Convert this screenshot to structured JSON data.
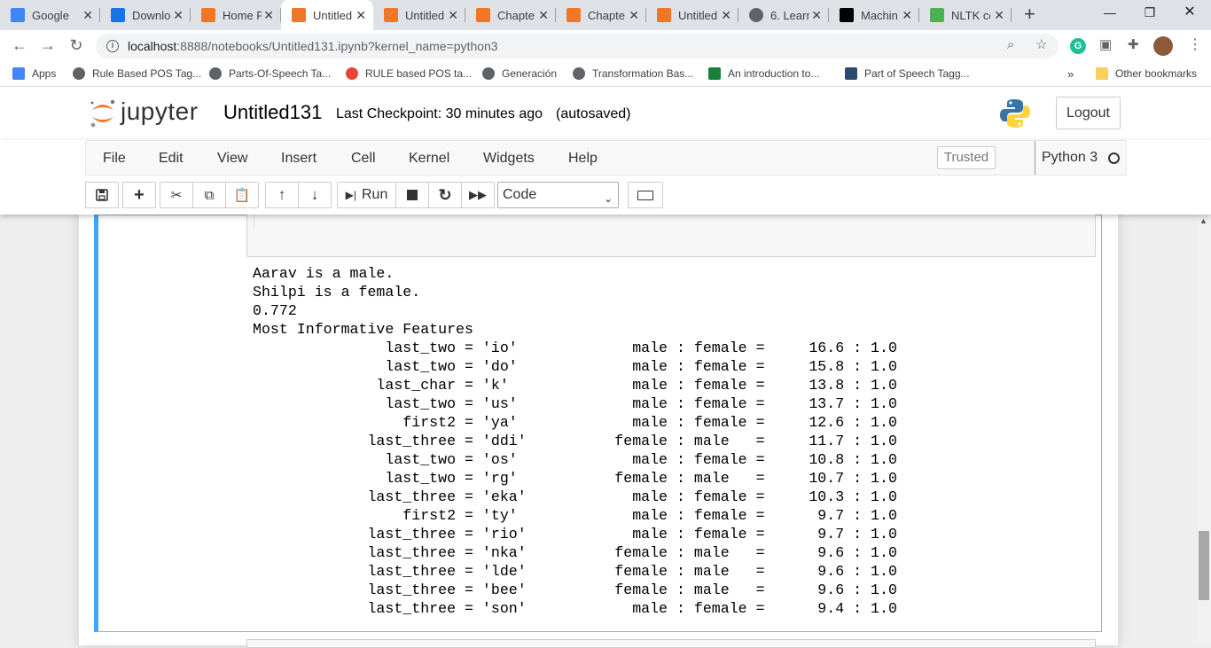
{
  "browser": {
    "tabs": [
      {
        "label": "Google",
        "icon": "google-docs-icon",
        "color": "#4285f4"
      },
      {
        "label": "Downlo",
        "icon": "download-icon",
        "color": "#1a73e8"
      },
      {
        "label": "Home P",
        "icon": "jupyter-icon",
        "color": "#f37626"
      },
      {
        "label": "Untitled",
        "icon": "notebook-icon",
        "color": "#f37626",
        "active": true
      },
      {
        "label": "Untitled",
        "icon": "notebook-icon",
        "color": "#f37626"
      },
      {
        "label": "Chapte",
        "icon": "notebook-icon",
        "color": "#f37626"
      },
      {
        "label": "Chapte",
        "icon": "notebook-icon",
        "color": "#f37626"
      },
      {
        "label": "Untitled",
        "icon": "notebook-icon",
        "color": "#f37626"
      },
      {
        "label": "6. Learn",
        "icon": "globe-icon",
        "color": "#5f6368"
      },
      {
        "label": "Machin",
        "icon": "medium-icon",
        "color": "#000000"
      },
      {
        "label": "NLTK co",
        "icon": "w3schools-icon",
        "color": "#4caf50"
      }
    ],
    "url_host": "localhost",
    "url_rest": ":8888/notebooks/Untitled131.ipynb?kernel_name=python3",
    "bookmarks": [
      {
        "label": "Apps",
        "icon": "apps-grid-icon"
      },
      {
        "label": "Rule Based POS Tag...",
        "icon": "globe-icon"
      },
      {
        "label": "Parts-Of-Speech Ta...",
        "icon": "globe-icon"
      },
      {
        "label": "RULE based POS ta...",
        "icon": "google-icon"
      },
      {
        "label": "Generación",
        "icon": "globe-icon"
      },
      {
        "label": "Transformation Bas...",
        "icon": "globe-icon"
      },
      {
        "label": "An introduction to...",
        "icon": "sheet-icon"
      },
      {
        "label": "Part of Speech Tagg...",
        "icon": "doc-icon"
      }
    ],
    "more_bookmarks": "»",
    "other_bookmarks": "Other bookmarks"
  },
  "jupyter": {
    "logo_text": "jupyter",
    "notebook_name": "Untitled131",
    "checkpoint": "Last Checkpoint: 30 minutes ago",
    "autosave": "(autosaved)",
    "logout": "Logout",
    "menus": [
      "File",
      "Edit",
      "View",
      "Insert",
      "Cell",
      "Kernel",
      "Widgets",
      "Help"
    ],
    "trusted": "Trusted",
    "kernel": "Python 3",
    "run_label": "Run",
    "cell_type": "Code"
  },
  "output": {
    "lines": [
      "Aarav is a male.",
      "Shilpi is a female.",
      "0.772",
      "Most Informative Features",
      "               last_two = 'io'             male : female =     16.6 : 1.0",
      "               last_two = 'do'             male : female =     15.8 : 1.0",
      "              last_char = 'k'              male : female =     13.8 : 1.0",
      "               last_two = 'us'             male : female =     13.7 : 1.0",
      "                 first2 = 'ya'             male : female =     12.6 : 1.0",
      "             last_three = 'ddi'          female : male   =     11.7 : 1.0",
      "               last_two = 'os'             male : female =     10.8 : 1.0",
      "               last_two = 'rg'           female : male   =     10.7 : 1.0",
      "             last_three = 'eka'            male : female =     10.3 : 1.0",
      "                 first2 = 'ty'             male : female =      9.7 : 1.0",
      "             last_three = 'rio'            male : female =      9.7 : 1.0",
      "             last_three = 'nka'          female : male   =      9.6 : 1.0",
      "             last_three = 'lde'          female : male   =      9.6 : 1.0",
      "             last_three = 'bee'          female : male   =      9.6 : 1.0",
      "             last_three = 'son'            male : female =      9.4 : 1.0"
    ]
  },
  "colors": {
    "cell_selected_border": "#42a5f5",
    "jupyter_orange": "#f37626"
  }
}
